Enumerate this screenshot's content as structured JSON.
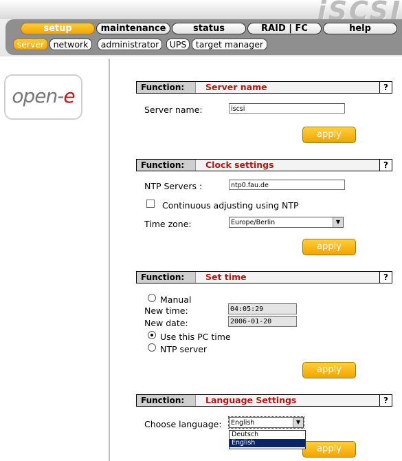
{
  "brand": {
    "product": "iSCSI",
    "logo_main": "open-",
    "logo_accent": "e"
  },
  "nav": {
    "main_tabs": [
      "setup",
      "maintenance",
      "status",
      "RAID | FC",
      "help"
    ],
    "active_main": "setup",
    "sub_tabs": [
      "server",
      "network",
      "administrator",
      "UPS",
      "target manager"
    ],
    "active_sub": "server"
  },
  "common": {
    "function_label": "Function:",
    "help": "?",
    "apply": "apply"
  },
  "server_name": {
    "title": "Server name",
    "label": "Server name:",
    "value": "iscsi"
  },
  "clock": {
    "title": "Clock settings",
    "ntp_label": "NTP Servers :",
    "ntp_value": "ntp0.fau.de",
    "continuous_label": "Continuous adjusting using NTP",
    "continuous_checked": false,
    "timezone_label": "Time zone:",
    "timezone_value": "Europe/Berlin"
  },
  "set_time": {
    "title": "Set time",
    "manual_label": "Manual",
    "new_time_label": "New time:",
    "new_time_value": "04:05:29",
    "new_date_label": "New date:",
    "new_date_value": "2006-01-20",
    "pc_time_label": "Use this PC time",
    "ntp_server_label": "NTP server",
    "selected_mode": "Use this PC time"
  },
  "language": {
    "title": "Language Settings",
    "label": "Choose language:",
    "value": "English",
    "options": [
      "Deutsch",
      "English"
    ],
    "highlighted": "English"
  },
  "colors": {
    "accent_orange": "#f2a600",
    "title_red": "#b01818",
    "nav_grey": "#8f8f8f",
    "list_highlight": "#0a246a"
  }
}
